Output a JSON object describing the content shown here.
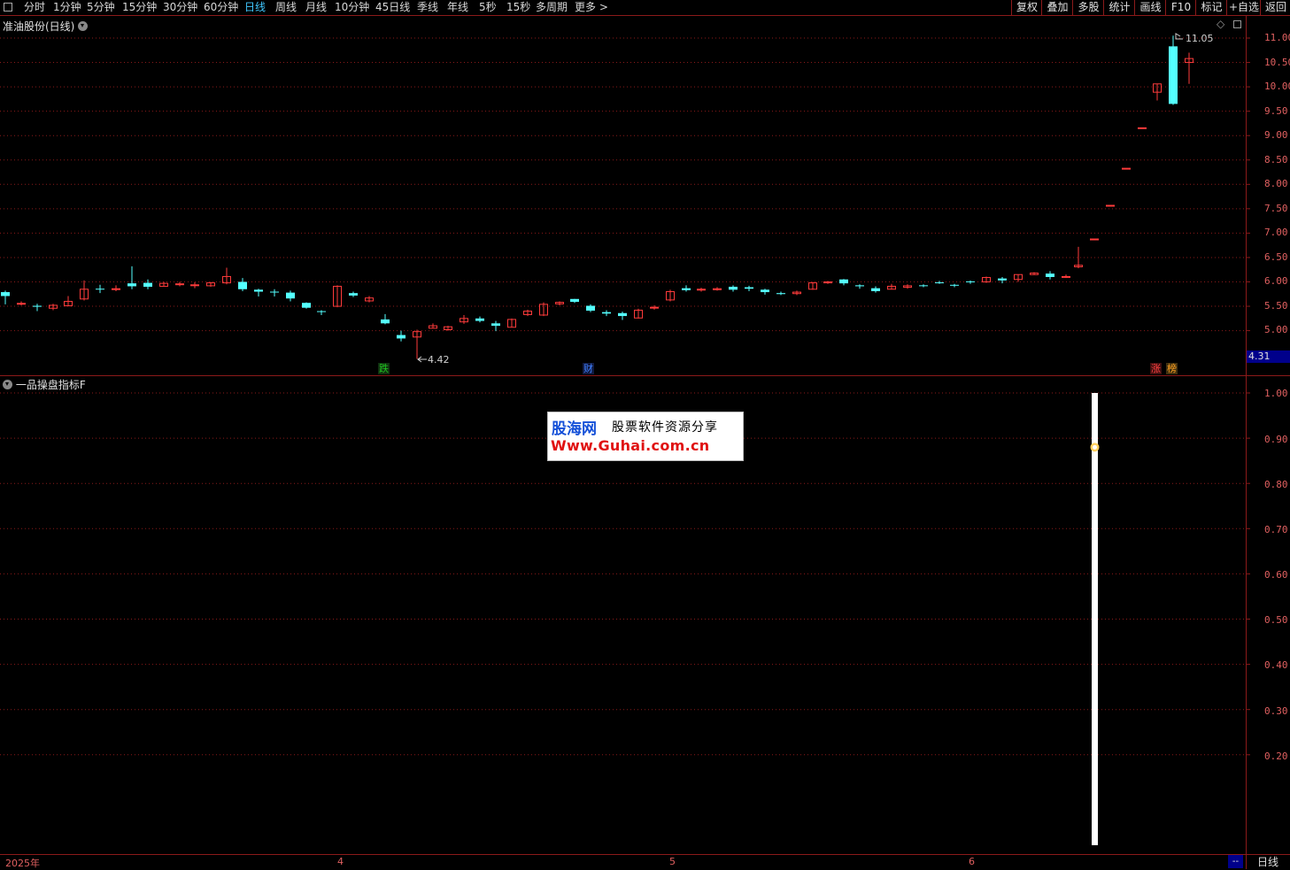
{
  "toolbar": {
    "tabs": [
      "分时",
      "1分钟",
      "5分钟",
      "15分钟",
      "30分钟",
      "60分钟",
      "日线",
      "周线",
      "月线",
      "10分钟",
      "45日线",
      "季线",
      "年线",
      "5秒",
      "15秒",
      "多周期",
      "更多 >"
    ],
    "active_tab": "日线",
    "right_buttons": [
      "复权",
      "叠加",
      "多股",
      "统计",
      "画线",
      "F10",
      "标记",
      "+自选",
      "返回"
    ]
  },
  "main_panel": {
    "title": "准油股份(日线)",
    "high_label": "11.05",
    "low_label": "4.42",
    "current_price": "4.31",
    "badges": [
      {
        "text": "跌",
        "color": "#20c020"
      },
      {
        "text": "财",
        "color": "#4080ff"
      },
      {
        "text": "涨",
        "color": "#ff4040"
      },
      {
        "text": "榜",
        "color": "#ffa020"
      }
    ],
    "price_ticks": [
      "11.00",
      "10.50",
      "10.00",
      "9.50",
      "9.00",
      "8.50",
      "8.00",
      "7.50",
      "7.00",
      "6.50",
      "6.00",
      "5.50",
      "5.00"
    ]
  },
  "indicator_panel": {
    "title": "一品操盘指标F",
    "ticks": [
      "1.00",
      "0.90",
      "0.80",
      "0.70",
      "0.60",
      "0.50",
      "0.40",
      "0.30",
      "0.20"
    ],
    "signal_value": 0.88
  },
  "watermark": {
    "brand": "股海网",
    "slogan": "股票软件资源分享",
    "url": "Www.Guhai.com.cn"
  },
  "x_axis": {
    "labels": [
      "2025年",
      "4",
      "5",
      "6"
    ],
    "end_marker": "--"
  },
  "bottom_button": "日线",
  "colors": {
    "up": "#ff3b3b",
    "down": "#54ffff",
    "grid": "#8b1a1a",
    "axis_text": "#e06060"
  },
  "candles": [
    [
      5.79,
      5.71,
      5.82,
      5.54
    ],
    [
      5.55,
      5.56,
      5.6,
      5.52
    ],
    [
      5.51,
      5.49,
      5.55,
      5.4
    ],
    [
      5.46,
      5.52,
      5.55,
      5.42
    ],
    [
      5.51,
      5.6,
      5.71,
      5.5
    ],
    [
      5.65,
      5.85,
      6.03,
      5.62
    ],
    [
      5.86,
      5.85,
      5.94,
      5.77
    ],
    [
      5.85,
      5.86,
      5.93,
      5.81
    ],
    [
      5.97,
      5.91,
      6.32,
      5.85
    ],
    [
      5.98,
      5.9,
      6.05,
      5.85
    ],
    [
      5.91,
      5.97,
      6.0,
      5.9
    ],
    [
      5.96,
      5.96,
      6.0,
      5.91
    ],
    [
      5.93,
      5.94,
      5.99,
      5.87
    ],
    [
      5.92,
      5.98,
      6.0,
      5.9
    ],
    [
      5.98,
      6.11,
      6.29,
      5.95
    ],
    [
      6.0,
      5.85,
      6.08,
      5.81
    ],
    [
      5.84,
      5.8,
      5.86,
      5.7
    ],
    [
      5.8,
      5.79,
      5.85,
      5.7
    ],
    [
      5.78,
      5.66,
      5.82,
      5.6
    ],
    [
      5.57,
      5.47,
      5.58,
      5.45
    ],
    [
      5.4,
      5.39,
      5.42,
      5.32
    ],
    [
      5.5,
      5.91,
      5.93,
      5.48
    ],
    [
      5.77,
      5.72,
      5.8,
      5.69
    ],
    [
      5.61,
      5.67,
      5.71,
      5.58
    ],
    [
      5.23,
      5.15,
      5.34,
      5.13
    ],
    [
      4.91,
      4.84,
      5.0,
      4.78
    ],
    [
      4.87,
      4.98,
      5.02,
      4.42
    ],
    [
      5.05,
      5.1,
      5.15,
      5.05
    ],
    [
      5.02,
      5.08,
      5.1,
      5.0
    ],
    [
      5.18,
      5.25,
      5.32,
      5.14
    ],
    [
      5.25,
      5.2,
      5.29,
      5.17
    ],
    [
      5.15,
      5.1,
      5.2,
      4.99
    ],
    [
      5.07,
      5.23,
      5.25,
      5.07
    ],
    [
      5.33,
      5.4,
      5.43,
      5.3
    ],
    [
      5.32,
      5.54,
      5.58,
      5.3
    ],
    [
      5.55,
      5.58,
      5.6,
      5.52
    ],
    [
      5.65,
      5.59,
      5.65,
      5.57
    ],
    [
      5.51,
      5.41,
      5.54,
      5.38
    ],
    [
      5.38,
      5.35,
      5.42,
      5.3
    ],
    [
      5.36,
      5.3,
      5.39,
      5.22
    ],
    [
      5.26,
      5.42,
      5.45,
      5.25
    ],
    [
      5.47,
      5.48,
      5.52,
      5.43
    ],
    [
      5.63,
      5.8,
      5.84,
      5.6
    ],
    [
      5.87,
      5.83,
      5.93,
      5.8
    ],
    [
      5.84,
      5.85,
      5.88,
      5.8
    ],
    [
      5.84,
      5.86,
      5.89,
      5.82
    ],
    [
      5.9,
      5.84,
      5.93,
      5.8
    ],
    [
      5.89,
      5.86,
      5.92,
      5.81
    ],
    [
      5.84,
      5.79,
      5.86,
      5.74
    ],
    [
      5.77,
      5.75,
      5.8,
      5.73
    ],
    [
      5.76,
      5.79,
      5.82,
      5.73
    ],
    [
      5.85,
      5.98,
      6.0,
      5.84
    ],
    [
      5.98,
      6.0,
      6.02,
      5.96
    ],
    [
      6.05,
      5.97,
      6.06,
      5.93
    ],
    [
      5.93,
      5.91,
      5.95,
      5.86
    ],
    [
      5.87,
      5.81,
      5.91,
      5.78
    ],
    [
      5.85,
      5.91,
      5.96,
      5.85
    ],
    [
      5.89,
      5.92,
      5.95,
      5.86
    ],
    [
      5.93,
      5.92,
      5.95,
      5.89
    ],
    [
      5.99,
      5.98,
      6.02,
      5.96
    ],
    [
      5.94,
      5.93,
      5.96,
      5.89
    ],
    [
      6.01,
      6.0,
      6.03,
      5.96
    ],
    [
      6.0,
      6.09,
      6.11,
      5.98
    ],
    [
      6.07,
      6.03,
      6.1,
      5.97
    ],
    [
      6.05,
      6.15,
      6.15,
      6.0
    ],
    [
      6.15,
      6.18,
      6.2,
      6.14
    ],
    [
      6.17,
      6.1,
      6.22,
      6.05
    ],
    [
      6.1,
      6.11,
      6.15,
      6.08
    ],
    [
      6.31,
      6.34,
      6.72,
      6.28
    ],
    [
      6.88,
      6.88,
      6.88,
      6.88
    ],
    [
      7.57,
      7.57,
      7.57,
      7.57
    ],
    [
      8.33,
      8.33,
      8.33,
      8.33
    ],
    [
      9.16,
      9.16,
      9.16,
      9.16
    ],
    [
      9.89,
      10.06,
      10.06,
      9.72
    ],
    [
      10.83,
      9.65,
      11.05,
      9.63
    ],
    [
      10.5,
      10.58,
      10.7,
      10.06
    ]
  ],
  "candle_x": [
    6,
    24,
    42,
    60,
    77,
    95,
    113,
    131,
    149,
    167,
    185,
    203,
    220,
    238,
    256,
    274,
    292,
    310,
    328,
    346,
    363,
    381,
    399,
    417,
    435,
    453,
    471,
    489,
    506,
    524,
    542,
    560,
    578,
    596,
    614,
    632,
    649,
    667,
    685,
    703,
    721,
    739,
    757,
    775,
    792,
    810,
    828,
    846,
    864,
    882,
    900,
    918,
    935,
    953,
    971,
    989,
    1007,
    1025,
    1043,
    1061,
    1078,
    1096,
    1114,
    1132,
    1150,
    1168,
    1186,
    1204,
    1218,
    1236,
    1254,
    1272,
    1290,
    1307,
    1325,
    1343
  ]
}
